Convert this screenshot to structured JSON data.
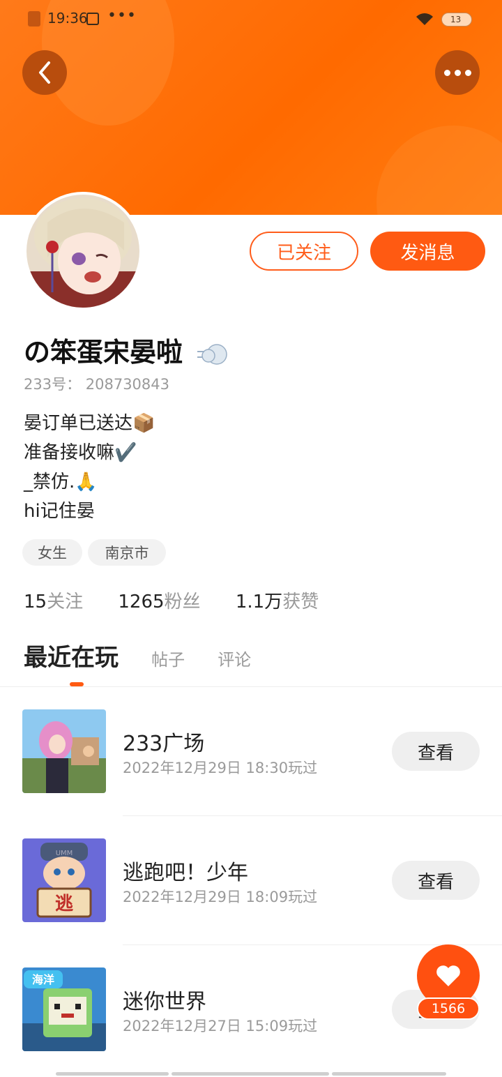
{
  "status_bar": {
    "time": "19:36",
    "more": "•••",
    "battery": "13"
  },
  "header": {
    "back_icon": "chevron-left-icon",
    "more_icon": "more-horizontal-icon",
    "gradient_color": "#ff6a00"
  },
  "profile": {
    "nickname": "の笨蛋宋晏啦",
    "uid": "233号： 208730843",
    "bio": [
      "晏订单已送达📦",
      "准备接收嘛✔️",
      "_禁仿.🙏",
      "hi记住晏"
    ],
    "tags": [
      "女生",
      "南京市"
    ],
    "follow_button": "已关注",
    "message_button": "发消息"
  },
  "stats": [
    {
      "num": "15",
      "label": "关注"
    },
    {
      "num": "1265",
      "label": "粉丝"
    },
    {
      "num": "1.1万",
      "label": "获赞"
    }
  ],
  "tabs": [
    "最近在玩",
    "帖子",
    "评论"
  ],
  "games": [
    {
      "title": "233广场",
      "played": "2022年12月29日 18:30玩过",
      "button": "查看"
    },
    {
      "title": "逃跑吧！少年",
      "played": "2022年12月29日 18:09玩过",
      "button": "查看"
    },
    {
      "title": "迷你世界",
      "played": "2022年12月27日 15:09玩过",
      "button": "查看"
    }
  ],
  "game_thumb_text": {
    "escape": "逃",
    "ocean": "海洋",
    "cap": "UMM"
  },
  "like": {
    "icon": "heart-icon",
    "count": "1566"
  },
  "accent_color": "#ff5a12"
}
